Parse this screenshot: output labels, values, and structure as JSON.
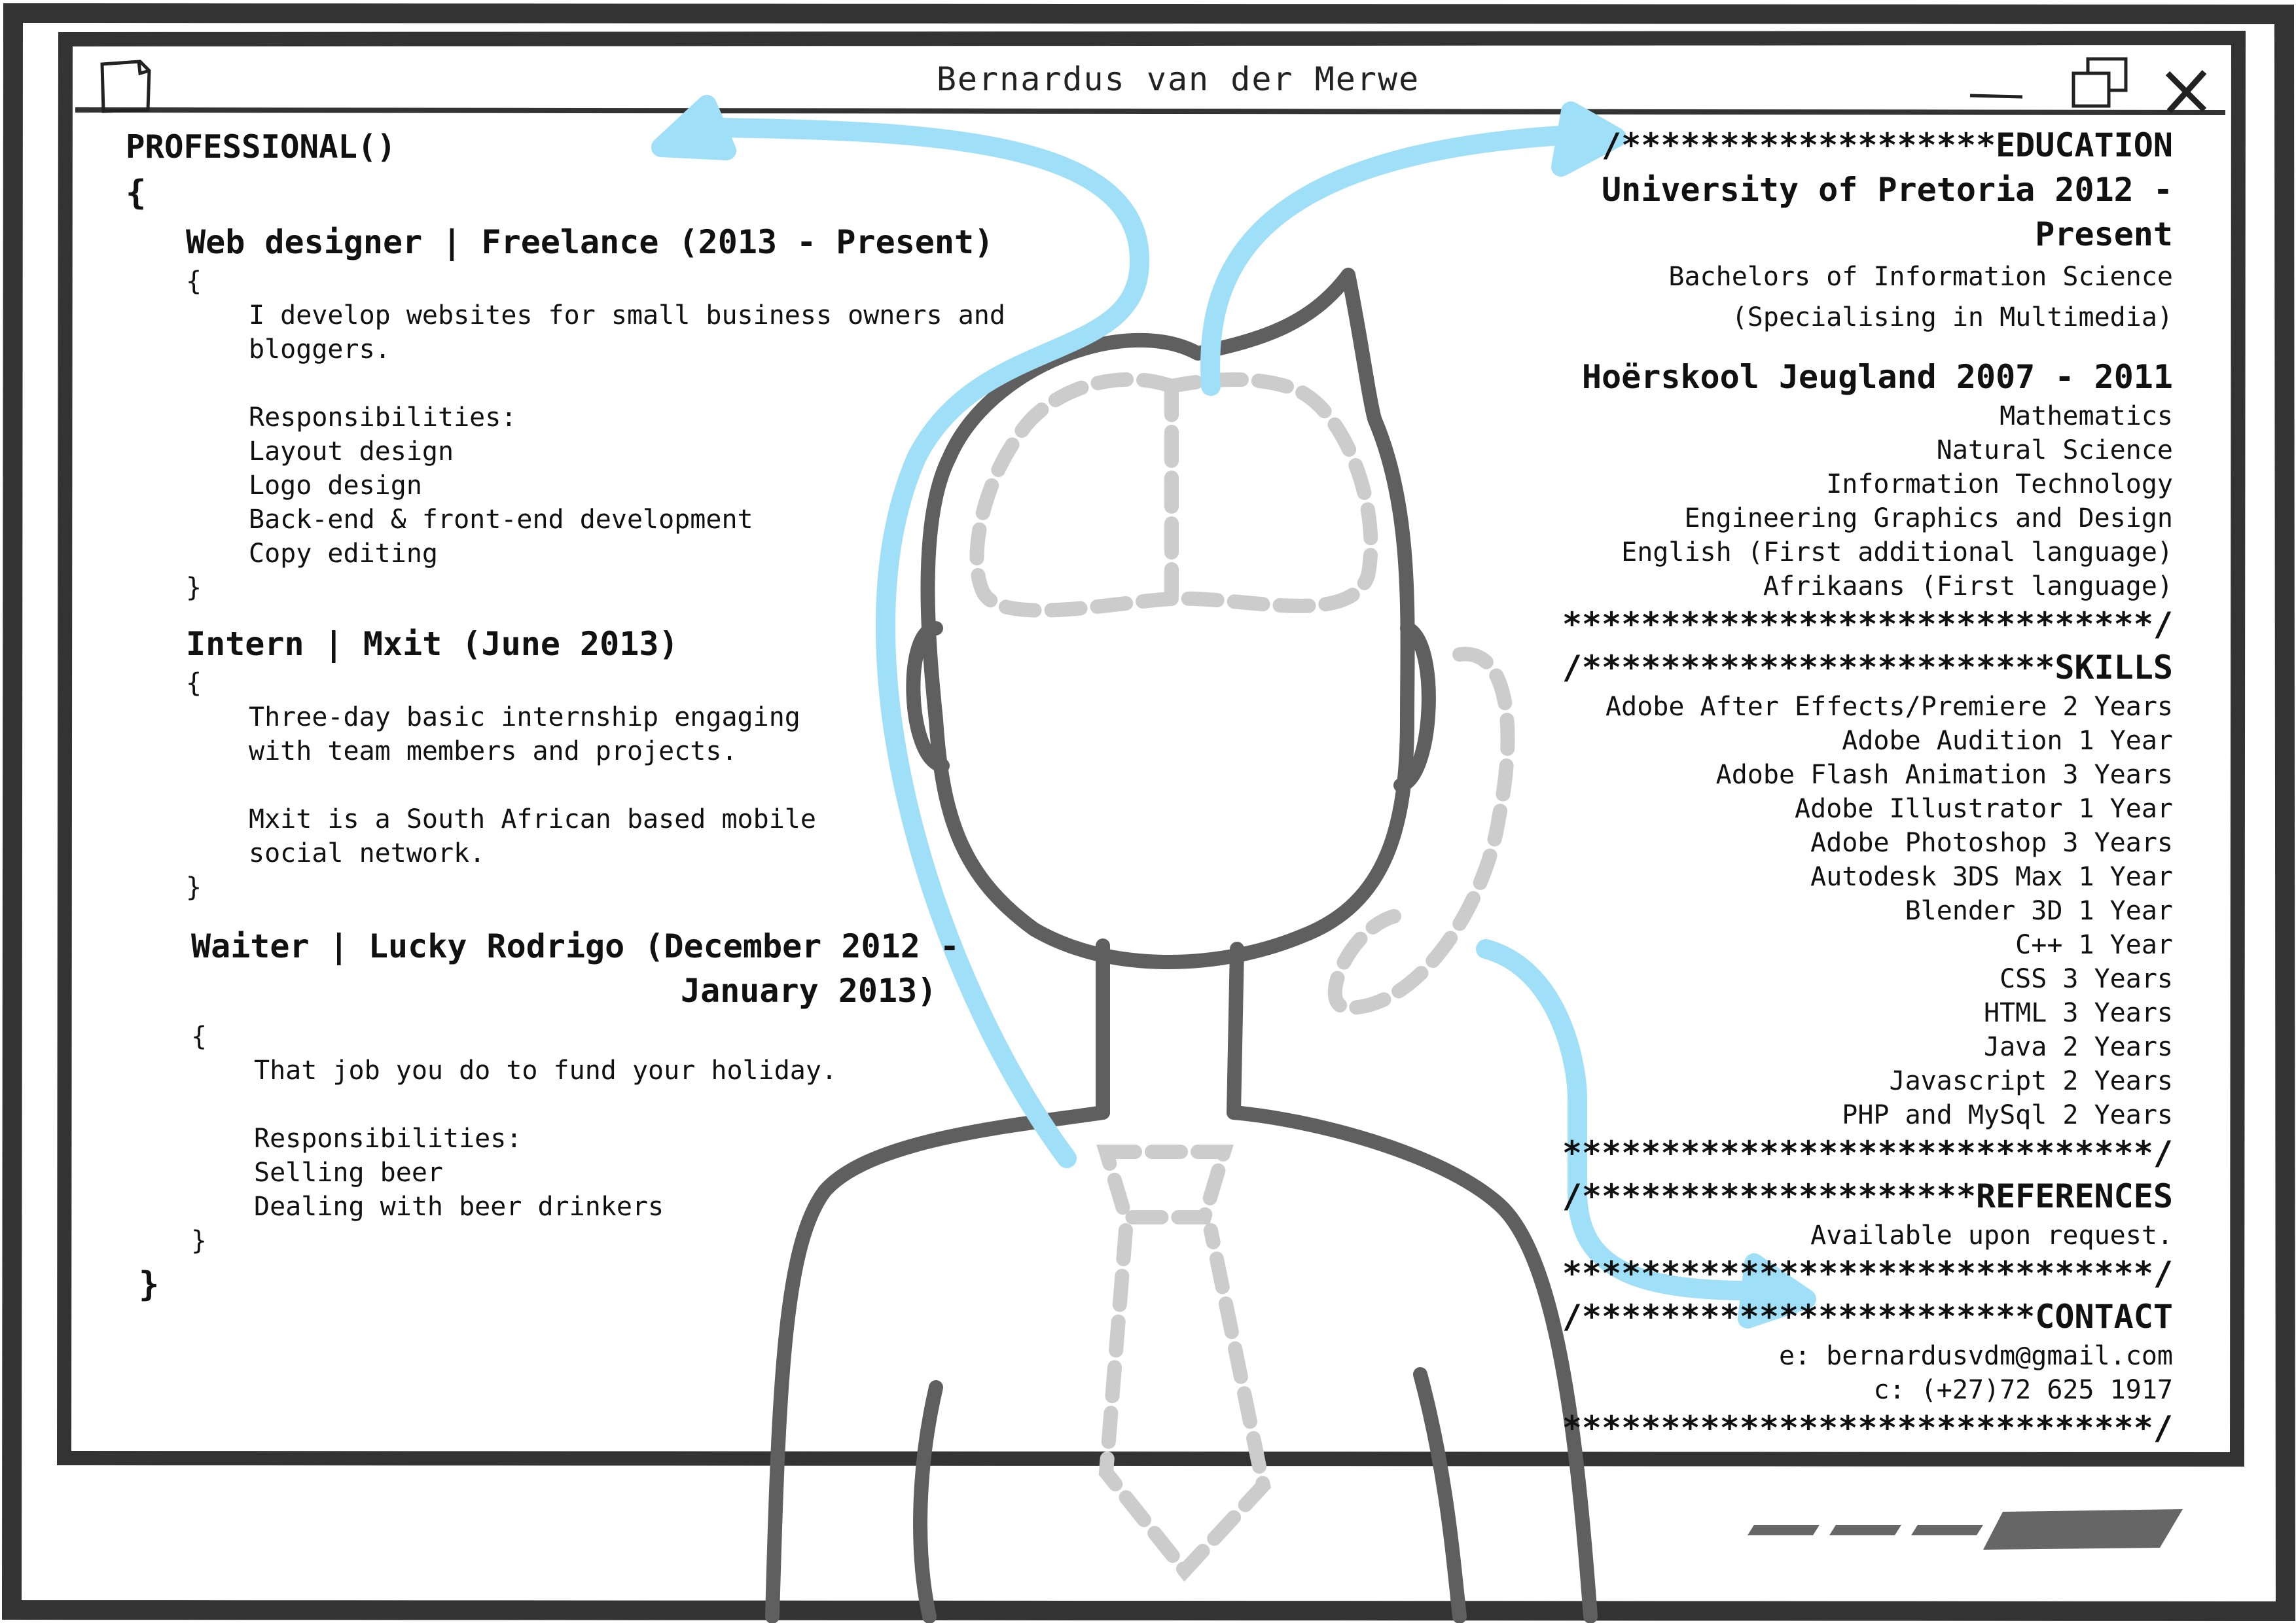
{
  "window": {
    "title": "Bernardus van der Merwe",
    "icons": [
      "document-icon",
      "minimize-icon",
      "maximize-icon",
      "close-icon"
    ]
  },
  "professional": {
    "heading": "PROFESSIONAL()",
    "open_brace": "{",
    "close_brace": "}",
    "jobs": [
      {
        "title": "Web designer | Freelance (2013 - Present)",
        "open": "{",
        "body": "I develop websites for small business owners and\nbloggers.\n\nResponsibilities:\nLayout design\nLogo design\nBack-end & front-end development\nCopy editing",
        "close": "}"
      },
      {
        "title": "Intern | Mxit (June 2013)",
        "open": "{",
        "body": "Three-day basic internship engaging\nwith team members and projects.\n\nMxit is a South African based mobile\nsocial network.",
        "close": "}"
      },
      {
        "title": "Waiter | Lucky Rodrigo (December 2012 -",
        "title_cont": "January 2013)",
        "open": "{",
        "body": "That job you do to fund your holiday.\n\nResponsibilities:\nSelling beer\nDealing with beer drinkers",
        "close": "}"
      }
    ]
  },
  "education": {
    "heading": "/*******************EDUCATION",
    "schools": [
      {
        "name_line1": "University of Pretoria 2012 -",
        "name_line2": "Present",
        "details": [
          "Bachelors of Information Science",
          "(Specialising in Multimedia)"
        ]
      },
      {
        "name_line1": "Hoërskool Jeugland 2007 - 2011",
        "details": [
          "Mathematics",
          "Natural Science",
          "Information Technology",
          "Engineering Graphics and Design",
          "English (First additional language)",
          "Afrikaans (First language)"
        ]
      }
    ],
    "close": "******************************/"
  },
  "skills": {
    "heading": "/************************SKILLS",
    "items": [
      "Adobe After Effects/Premiere 2 Years",
      "Adobe Audition 1 Year",
      "Adobe Flash Animation 3 Years",
      "Adobe Illustrator 1 Year",
      "Adobe Photoshop 3 Years",
      "Autodesk 3DS Max 1 Year",
      "Blender 3D 1 Year",
      "C++ 1 Year",
      "CSS 3 Years",
      "HTML 3 Years",
      "Java 2 Years",
      "Javascript 2 Years",
      "PHP and MySql 2 Years"
    ],
    "close": "******************************/"
  },
  "references": {
    "heading": "/********************REFERENCES",
    "text": "Available upon request.",
    "close": "******************************/"
  },
  "contact": {
    "heading": "/***********************CONTACT",
    "email": "e: bernardusvdm@gmail.com",
    "phone": "c: (+27)72 625 1917",
    "close": "******************************/"
  },
  "colors": {
    "frame": "#333333",
    "figure": "#5f5f5f",
    "dashed": "#cccccc",
    "arrow": "#9fe0f8"
  }
}
